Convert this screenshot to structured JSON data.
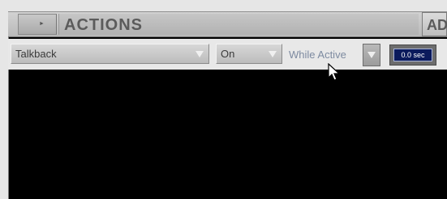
{
  "header": {
    "title": "ACTIONS",
    "add_label": "ADD",
    "collapse_icon": "small-right-arrow"
  },
  "action_row": {
    "action_select": {
      "value": "Talkback"
    },
    "state_select": {
      "value": "On"
    },
    "mode_select": {
      "value": "While Active"
    },
    "delay_value": "0.0 sec"
  },
  "colors": {
    "panel_background": "#000000",
    "delay_display": "#0b1a5c",
    "chrome": "#c6c6c6"
  }
}
